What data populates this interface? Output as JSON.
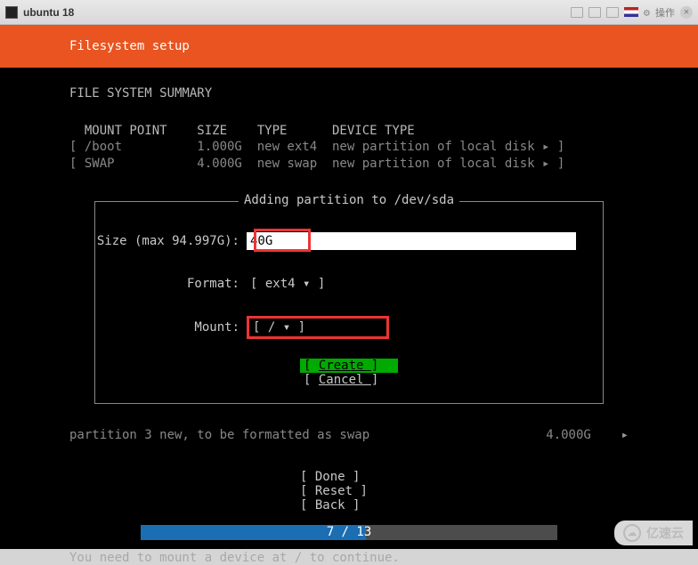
{
  "titlebar": {
    "title": "ubuntu 18",
    "action_text": "操作"
  },
  "header": {
    "title": "Filesystem setup"
  },
  "summary": {
    "heading": "FILE SYSTEM SUMMARY",
    "columns": "  MOUNT POINT    SIZE    TYPE      DEVICE TYPE",
    "rows": [
      "[ /boot          1.000G  new ext4  new partition of local disk ▸ ]",
      "[ SWAP           4.000G  new swap  new partition of local disk ▸ ]"
    ]
  },
  "dialog": {
    "title": " Adding partition to /dev/sda ",
    "size_label": "Size (max 94.997G):",
    "size_value": "40G",
    "format_label": "Format:",
    "format_value": "[ ext4             ▾ ]",
    "mount_label": "Mount:",
    "mount_value": "[ /              ▾ ]",
    "create": "Create     ",
    "cancel": "Cancel     "
  },
  "partition_info": {
    "left": "partition 3  new, to be formatted as swap",
    "right_size": "4.000G",
    "arrow": "▸"
  },
  "nav": {
    "done": "Done      ",
    "reset": "Reset     ",
    "back": "Back      "
  },
  "progress": {
    "text": "7 / 13"
  },
  "hint": "You need to mount a device at / to continue.",
  "watermark": "亿速云"
}
